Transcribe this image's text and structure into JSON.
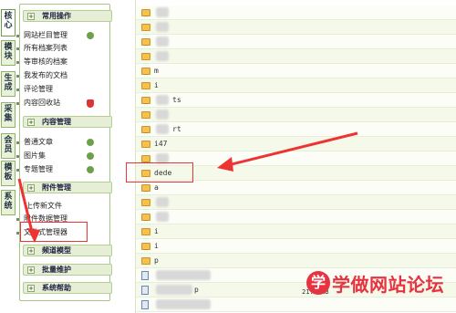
{
  "vtabs": [
    {
      "label": "核心",
      "active": true
    },
    {
      "label": "模块"
    },
    {
      "label": "生成"
    },
    {
      "label": "采集"
    },
    {
      "label": "会员"
    },
    {
      "label": "模板"
    },
    {
      "label": "系统"
    }
  ],
  "sidebar": {
    "sections": {
      "common": {
        "title": "常用操作",
        "items": [
          "网站栏目管理",
          "所有档案列表",
          "等审核的档案",
          "我发布的文档",
          "评论管理",
          "内容回收站"
        ]
      },
      "content": {
        "title": "内容管理",
        "items": [
          "普通文章",
          "图片集",
          "专题管理"
        ]
      },
      "attach": {
        "title": "附件管理",
        "items": [
          "上传新文件",
          "附件数据管理",
          "文件式管理器"
        ]
      },
      "channel": {
        "title": "频道模型"
      },
      "batch": {
        "title": "批量维护"
      },
      "help": {
        "title": "系统帮助"
      }
    }
  },
  "filelist": {
    "rows": [
      {
        "type": "folder",
        "name": ""
      },
      {
        "type": "folder",
        "name": ""
      },
      {
        "type": "folder",
        "name": ""
      },
      {
        "type": "folder",
        "name": ""
      },
      {
        "type": "folder",
        "name": "m"
      },
      {
        "type": "folder",
        "name": "i"
      },
      {
        "type": "folder",
        "name": "ts"
      },
      {
        "type": "folder",
        "name": ""
      },
      {
        "type": "folder",
        "name": "rt"
      },
      {
        "type": "folder",
        "name": "i47"
      },
      {
        "type": "folder",
        "name": ""
      },
      {
        "type": "folder",
        "name": "dede"
      },
      {
        "type": "folder",
        "name": "a"
      },
      {
        "type": "folder",
        "name": ""
      },
      {
        "type": "folder",
        "name": ""
      },
      {
        "type": "folder",
        "name": "i"
      },
      {
        "type": "folder",
        "name": "i"
      },
      {
        "type": "folder",
        "name": "p"
      },
      {
        "type": "file",
        "name": ""
      },
      {
        "type": "file",
        "name": "p"
      },
      {
        "type": "file",
        "name": "",
        "size": "21.1 KB"
      }
    ]
  },
  "watermark": {
    "badge": "学",
    "text": "学做网站论坛"
  },
  "colors": {
    "accent": "#e6333f",
    "sidebar_head": "#e6efd6",
    "folder": "#f2c14e"
  }
}
